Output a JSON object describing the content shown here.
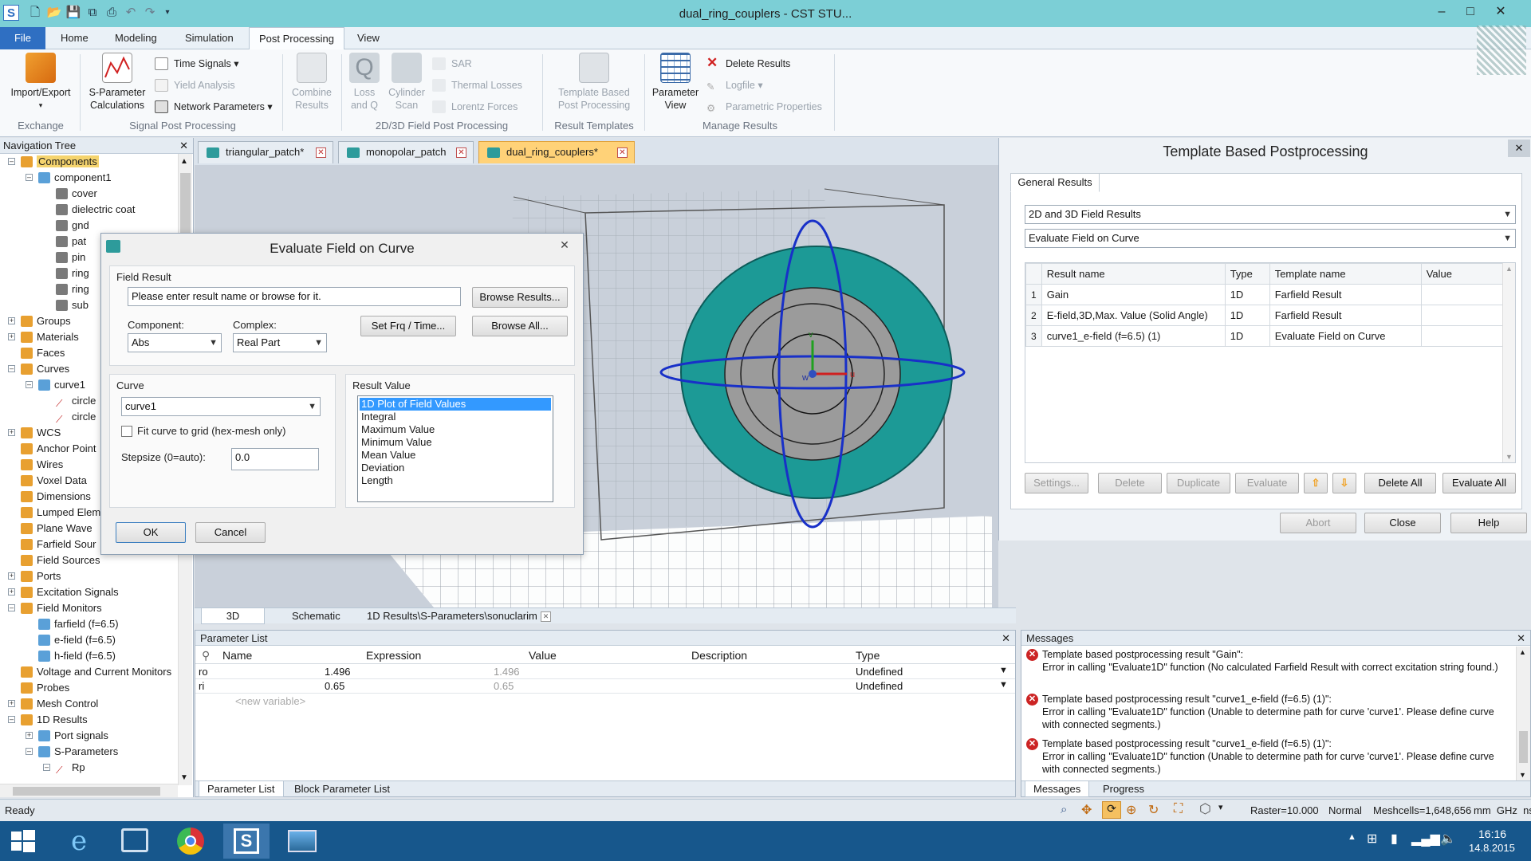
{
  "window": {
    "title": "dual_ring_couplers - CST STU...",
    "controls": {
      "minimize": "–",
      "maximize": "□",
      "close": "✕"
    }
  },
  "ribbon_tabs": [
    "File",
    "Home",
    "Modeling",
    "Simulation",
    "Post Processing",
    "View"
  ],
  "ribbon": {
    "import_export": "Import/Export",
    "exchange_label": "Exchange",
    "sparam_calc": "S-Parameter Calculations",
    "time_signals": "Time Signals",
    "yield_analysis": "Yield Analysis",
    "network_params": "Network Parameters",
    "signal_pp_label": "Signal Post Processing",
    "combine_results": "Combine Results",
    "loss_and_q": "Loss and Q",
    "cylinder_scan": "Cylinder Scan",
    "sar": "SAR",
    "thermal_losses": "Thermal Losses",
    "lorentz_forces": "Lorentz Forces",
    "field_pp_label": "2D/3D Field Post Processing",
    "template_based": "Template Based Post Processing",
    "result_templates_label": "Result Templates",
    "parameter_view": "Parameter View",
    "delete_results": "Delete Results",
    "logfile": "Logfile",
    "parametric_properties": "Parametric Properties",
    "manage_results_label": "Manage Results"
  },
  "nav": {
    "header": "Navigation Tree",
    "close": "✕",
    "items": [
      {
        "label": "Components",
        "level": 0,
        "exp": "–",
        "highlight": true
      },
      {
        "label": "component1",
        "level": 1,
        "exp": "–"
      },
      {
        "label": "cover",
        "level": 2
      },
      {
        "label": "dielectric coat",
        "level": 2
      },
      {
        "label": "gnd",
        "level": 2
      },
      {
        "label": "pat",
        "level": 2
      },
      {
        "label": "pin",
        "level": 2
      },
      {
        "label": "ring",
        "level": 2
      },
      {
        "label": "ring",
        "level": 2
      },
      {
        "label": "sub",
        "level": 2
      },
      {
        "label": "Groups",
        "level": 0,
        "exp": "+"
      },
      {
        "label": "Materials",
        "level": 0,
        "exp": "+"
      },
      {
        "label": "Faces",
        "level": 0
      },
      {
        "label": "Curves",
        "level": 0,
        "exp": "–"
      },
      {
        "label": "curve1",
        "level": 1,
        "exp": "–"
      },
      {
        "label": "circle",
        "level": 2
      },
      {
        "label": "circle",
        "level": 2
      },
      {
        "label": "WCS",
        "level": 0,
        "exp": "+"
      },
      {
        "label": "Anchor Point",
        "level": 0
      },
      {
        "label": "Wires",
        "level": 0
      },
      {
        "label": "Voxel Data",
        "level": 0
      },
      {
        "label": "Dimensions",
        "level": 0
      },
      {
        "label": "Lumped Elem",
        "level": 0
      },
      {
        "label": "Plane Wave",
        "level": 0
      },
      {
        "label": "Farfield Sour",
        "level": 0
      },
      {
        "label": "Field Sources",
        "level": 0
      },
      {
        "label": "Ports",
        "level": 0,
        "exp": "+"
      },
      {
        "label": "Excitation Signals",
        "level": 0,
        "exp": "+"
      },
      {
        "label": "Field Monitors",
        "level": 0,
        "exp": "–"
      },
      {
        "label": "farfield (f=6.5)",
        "level": 1
      },
      {
        "label": "e-field (f=6.5)",
        "level": 1
      },
      {
        "label": "h-field (f=6.5)",
        "level": 1
      },
      {
        "label": "Voltage and Current Monitors",
        "level": 0
      },
      {
        "label": "Probes",
        "level": 0
      },
      {
        "label": "Mesh Control",
        "level": 0,
        "exp": "+"
      },
      {
        "label": "1D Results",
        "level": 0,
        "exp": "–"
      },
      {
        "label": "Port signals",
        "level": 1,
        "exp": "+"
      },
      {
        "label": "S-Parameters",
        "level": 1,
        "exp": "–"
      },
      {
        "label": "Rp",
        "level": 2,
        "exp": "–"
      }
    ]
  },
  "doc_tabs": [
    {
      "label": "triangular_patch*",
      "active": false
    },
    {
      "label": "monopolar_patch",
      "active": false
    },
    {
      "label": "dual_ring_couplers*",
      "active": true
    }
  ],
  "view_tabs": [
    "3D",
    "Schematic",
    "1D Results\\S-Parameters\\sonuclarim"
  ],
  "eval_dialog": {
    "title": "Evaluate Field on Curve",
    "field_result_label": "Field Result",
    "result_name_value": "Please enter result name or browse for it.",
    "browse_results": "Browse Results...",
    "component_label": "Component:",
    "component_value": "Abs",
    "complex_label": "Complex:",
    "complex_value": "Real Part",
    "set_frq": "Set Frq / Time...",
    "browse_all": "Browse All...",
    "curve_label": "Curve",
    "curve_value": "curve1",
    "fit_curve": "Fit curve to grid (hex-mesh only)",
    "stepsize_label": "Stepsize (0=auto):",
    "stepsize_value": "0.0",
    "result_value_label": "Result Value",
    "result_options": [
      "1D Plot of Field Values",
      "Integral",
      "Maximum Value",
      "Minimum Value",
      "Mean Value",
      "Deviation",
      "Length"
    ],
    "selected_option": 0,
    "ok": "OK",
    "cancel": "Cancel",
    "close": "✕"
  },
  "template_panel": {
    "title": "Template Based Postprocessing",
    "close": "✕",
    "tab": "General Results",
    "category": "2D and 3D Field Results",
    "template": "Evaluate Field on Curve",
    "columns": [
      "Result name",
      "Type",
      "Template name",
      "Value"
    ],
    "rows": [
      {
        "n": "1",
        "name": "Gain",
        "type": "1D",
        "template": "Farfield Result",
        "value": ""
      },
      {
        "n": "2",
        "name": "E-field,3D,Max. Value (Solid Angle)",
        "type": "1D",
        "template": "Farfield Result",
        "value": ""
      },
      {
        "n": "3",
        "name": "curve1_e-field (f=6.5) (1)",
        "type": "1D",
        "template": "Evaluate Field on Curve",
        "value": ""
      }
    ],
    "buttons": {
      "settings": "Settings...",
      "delete": "Delete",
      "duplicate": "Duplicate",
      "evaluate": "Evaluate",
      "delete_all": "Delete All",
      "evaluate_all": "Evaluate All",
      "abort": "Abort",
      "close_btn": "Close",
      "help": "Help"
    }
  },
  "param_list": {
    "header": "Parameter List",
    "close": "✕",
    "columns": [
      "Name",
      "Expression",
      "Value",
      "Description",
      "Type"
    ],
    "rows": [
      {
        "name": "ro",
        "expr": "1.496",
        "value": "1.496",
        "desc": "",
        "type": "Undefined"
      },
      {
        "name": "ri",
        "expr": "0.65",
        "value": "0.65",
        "desc": "",
        "type": "Undefined"
      }
    ],
    "new_variable": "<new variable>",
    "tabs": [
      "Parameter List",
      "Block Parameter List"
    ]
  },
  "messages": {
    "header": "Messages",
    "close": "✕",
    "items": [
      {
        "line1": "Template based postprocessing result \"Gain\":",
        "line2": "Error in calling \"Evaluate1D\" function (No calculated Farfield Result with correct excitation string found.)"
      },
      {
        "line1": "Template based postprocessing result \"curve1_e-field (f=6.5) (1)\":",
        "line2": "Error in calling \"Evaluate1D\" function (Unable to determine path for curve 'curve1'. Please define curve with connected segments.)"
      },
      {
        "line1": "Template based postprocessing result \"curve1_e-field (f=6.5) (1)\":",
        "line2": "Error in calling \"Evaluate1D\" function (Unable to determine path for curve 'curve1'. Please define curve with connected segments.)"
      }
    ],
    "tabs": [
      "Messages",
      "Progress"
    ]
  },
  "status": {
    "ready": "Ready",
    "raster": "Raster=10.000",
    "mode": "Normal",
    "meshcells": "Meshcells=1,648,656",
    "units": "mm  GHz  ns  K"
  },
  "taskbar": {
    "time": "16:16",
    "date": "14.8.2015"
  },
  "colors": {
    "accent": "#2f6fc2",
    "titlebar": "#7ccfd6",
    "active_tab": "#ffd278",
    "substrate": "#1c9a96",
    "ring": "#9b9b9b",
    "error": "#cc2424"
  }
}
